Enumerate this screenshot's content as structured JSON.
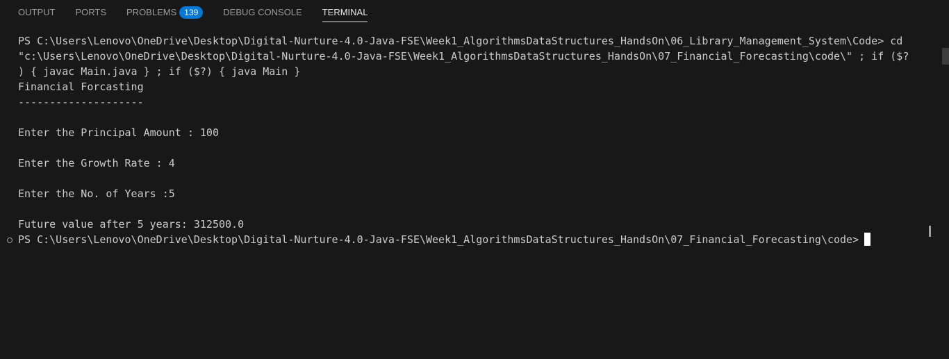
{
  "tabs": [
    {
      "label": "OUTPUT"
    },
    {
      "label": "PORTS"
    },
    {
      "label": "PROBLEMS",
      "badge": "139"
    },
    {
      "label": "DEBUG CONSOLE"
    },
    {
      "label": "TERMINAL",
      "active": true
    }
  ],
  "terminal": {
    "lines": [
      "PS C:\\Users\\Lenovo\\OneDrive\\Desktop\\Digital-Nurture-4.0-Java-FSE\\Week1_AlgorithmsDataStructures_HandsOn\\06_Library_Management_System\\Code> cd",
      "\"c:\\Users\\Lenovo\\OneDrive\\Desktop\\Digital-Nurture-4.0-Java-FSE\\Week1_AlgorithmsDataStructures_HandsOn\\07_Financial_Forecasting\\code\\\" ; if ($?",
      ") { javac Main.java } ; if ($?) { java Main }",
      "Financial Forcasting",
      "--------------------",
      "",
      "Enter the Principal Amount : 100",
      "",
      "Enter the Growth Rate : 4",
      "",
      "Enter the No. of Years :5",
      "",
      "Future value after 5 years: 312500.0",
      "PS C:\\Users\\Lenovo\\OneDrive\\Desktop\\Digital-Nurture-4.0-Java-FSE\\Week1_AlgorithmsDataStructures_HandsOn\\07_Financial_Forecasting\\code>"
    ]
  },
  "colors": {
    "background": "#181818",
    "text": "#cccccc",
    "tab_inactive": "#9d9d9d",
    "tab_active": "#e7e7e7",
    "badge": "#0078d4"
  }
}
